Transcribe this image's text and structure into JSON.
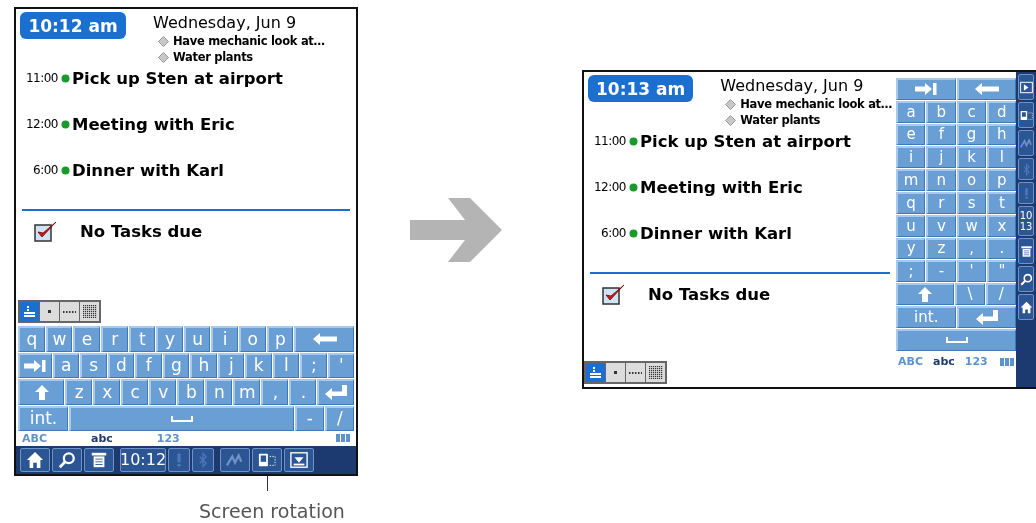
{
  "portrait": {
    "clock": "10:12 am",
    "date": "Wednesday, Jun 9",
    "task_previews": [
      "Have mechanic look at…",
      "Water plants"
    ],
    "appointments": [
      {
        "time": "11:00",
        "title": "Pick up Sten at airport"
      },
      {
        "time": "12:00",
        "title": "Meeting with Eric"
      },
      {
        "time": "6:00",
        "title": "Dinner with Karl"
      }
    ],
    "tasks_status": "No Tasks due",
    "view_buttons": [
      {
        "kind": "list",
        "selected": true
      },
      {
        "kind": "dot",
        "selected": false
      },
      {
        "kind": "line",
        "selected": false
      },
      {
        "kind": "grid",
        "selected": false
      }
    ],
    "keyboard": [
      [
        {
          "kind": "char",
          "label": "q"
        },
        {
          "kind": "char",
          "label": "w"
        },
        {
          "kind": "char",
          "label": "e"
        },
        {
          "kind": "char",
          "label": "r"
        },
        {
          "kind": "char",
          "label": "t"
        },
        {
          "kind": "char",
          "label": "y"
        },
        {
          "kind": "char",
          "label": "u"
        },
        {
          "kind": "char",
          "label": "i"
        },
        {
          "kind": "char",
          "label": "o"
        },
        {
          "kind": "char",
          "label": "p"
        },
        {
          "kind": "backspace"
        }
      ],
      [
        {
          "kind": "tab"
        },
        {
          "kind": "char",
          "label": "a"
        },
        {
          "kind": "char",
          "label": "s"
        },
        {
          "kind": "char",
          "label": "d"
        },
        {
          "kind": "char",
          "label": "f"
        },
        {
          "kind": "char",
          "label": "g"
        },
        {
          "kind": "char",
          "label": "h"
        },
        {
          "kind": "char",
          "label": "j"
        },
        {
          "kind": "char",
          "label": "k"
        },
        {
          "kind": "char",
          "label": "l"
        },
        {
          "kind": "char",
          "label": ";"
        },
        {
          "kind": "char",
          "label": "'"
        }
      ],
      [
        {
          "kind": "shift"
        },
        {
          "kind": "char",
          "label": "z"
        },
        {
          "kind": "char",
          "label": "x"
        },
        {
          "kind": "char",
          "label": "c"
        },
        {
          "kind": "char",
          "label": "v"
        },
        {
          "kind": "char",
          "label": "b"
        },
        {
          "kind": "char",
          "label": "n"
        },
        {
          "kind": "char",
          "label": "m"
        },
        {
          "kind": "char",
          "label": ","
        },
        {
          "kind": "char",
          "label": "."
        },
        {
          "kind": "enter"
        }
      ],
      [
        {
          "kind": "mode",
          "label": "int."
        },
        {
          "kind": "space"
        },
        {
          "kind": "char",
          "label": "-"
        },
        {
          "kind": "char",
          "label": "/"
        }
      ]
    ],
    "input_modes": [
      {
        "label": "ABC",
        "selected": false
      },
      {
        "label": "abc",
        "selected": true
      },
      {
        "label": "123",
        "selected": false
      }
    ],
    "status_bar": {
      "clock": "10:12"
    }
  },
  "landscape": {
    "clock": "10:13 am",
    "date": "Wednesday, Jun 9",
    "task_previews": [
      "Have mechanic look at…",
      "Water plants"
    ],
    "appointments": [
      {
        "time": "11:00",
        "title": "Pick up Sten at airport"
      },
      {
        "time": "12:00",
        "title": "Meeting with Eric"
      },
      {
        "time": "6:00",
        "title": "Dinner with Karl"
      }
    ],
    "tasks_status": "No Tasks due",
    "view_buttons": [
      {
        "kind": "list",
        "selected": true
      },
      {
        "kind": "dot",
        "selected": false
      },
      {
        "kind": "line",
        "selected": false
      },
      {
        "kind": "grid",
        "selected": false
      }
    ],
    "keyboard": [
      [
        {
          "kind": "tab"
        },
        {
          "kind": "backspace"
        }
      ],
      [
        {
          "kind": "char",
          "label": "a"
        },
        {
          "kind": "char",
          "label": "b"
        },
        {
          "kind": "char",
          "label": "c"
        },
        {
          "kind": "char",
          "label": "d"
        }
      ],
      [
        {
          "kind": "char",
          "label": "e"
        },
        {
          "kind": "char",
          "label": "f"
        },
        {
          "kind": "char",
          "label": "g"
        },
        {
          "kind": "char",
          "label": "h"
        }
      ],
      [
        {
          "kind": "char",
          "label": "i"
        },
        {
          "kind": "char",
          "label": "j"
        },
        {
          "kind": "char",
          "label": "k"
        },
        {
          "kind": "char",
          "label": "l"
        }
      ],
      [
        {
          "kind": "char",
          "label": "m"
        },
        {
          "kind": "char",
          "label": "n"
        },
        {
          "kind": "char",
          "label": "o"
        },
        {
          "kind": "char",
          "label": "p"
        }
      ],
      [
        {
          "kind": "char",
          "label": "q"
        },
        {
          "kind": "char",
          "label": "r"
        },
        {
          "kind": "char",
          "label": "s"
        },
        {
          "kind": "char",
          "label": "t"
        }
      ],
      [
        {
          "kind": "char",
          "label": "u"
        },
        {
          "kind": "char",
          "label": "v"
        },
        {
          "kind": "char",
          "label": "w"
        },
        {
          "kind": "char",
          "label": "x"
        }
      ],
      [
        {
          "kind": "char",
          "label": "y"
        },
        {
          "kind": "char",
          "label": "z"
        },
        {
          "kind": "char",
          "label": ","
        },
        {
          "kind": "char",
          "label": "."
        }
      ],
      [
        {
          "kind": "char",
          "label": ";"
        },
        {
          "kind": "char",
          "label": "-"
        },
        {
          "kind": "char",
          "label": "'"
        },
        {
          "kind": "char",
          "label": "\""
        }
      ],
      [
        {
          "kind": "shift"
        },
        {
          "kind": "char",
          "label": "\\"
        },
        {
          "kind": "char",
          "label": "/"
        }
      ],
      [
        {
          "kind": "mode",
          "label": "int."
        },
        {
          "kind": "enter"
        }
      ],
      [
        {
          "kind": "space"
        }
      ]
    ],
    "input_modes": [
      {
        "label": "ABC",
        "selected": false
      },
      {
        "label": "abc",
        "selected": true
      },
      {
        "label": "123",
        "selected": false
      }
    ],
    "status_bar": {
      "clock_lines": [
        "10",
        "13"
      ]
    }
  },
  "caption": "Screen rotation"
}
